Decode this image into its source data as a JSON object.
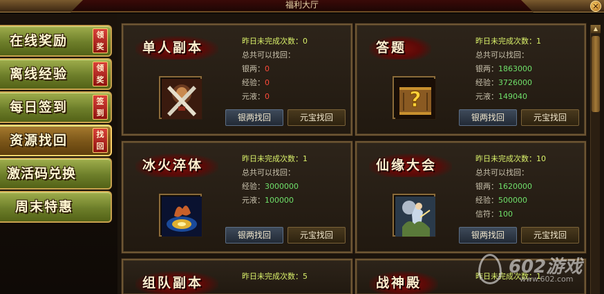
{
  "window": {
    "title": "福利大厅",
    "close_glyph": "✕"
  },
  "sidebar": {
    "items": [
      {
        "label": "在线奖励",
        "tag": "领奖",
        "active": false
      },
      {
        "label": "离线经验",
        "tag": "领奖",
        "active": false
      },
      {
        "label": "每日签到",
        "tag": "签到",
        "active": false
      },
      {
        "label": "资源找回",
        "tag": "找回",
        "active": true
      },
      {
        "label": "激活码兑换",
        "tag": "",
        "active": false
      },
      {
        "label": "周末特惠",
        "tag": "",
        "active": false
      }
    ]
  },
  "cards": [
    {
      "name": "单人副本",
      "icon": "crossed-swords-icon",
      "line1": "昨日未完成次数：0",
      "line2": "总共可以找回：",
      "rows": [
        {
          "label": "银两：",
          "value": "0",
          "zero": true
        },
        {
          "label": "经验：",
          "value": "0",
          "zero": true
        },
        {
          "label": "元液：",
          "value": "0",
          "zero": true
        }
      ],
      "btn_silver": "银两找回",
      "btn_gold": "元宝找回"
    },
    {
      "name": "答题",
      "icon": "question-scroll-icon",
      "line1": "昨日未完成次数：1",
      "line2": "总共可以找回：",
      "rows": [
        {
          "label": "银两：",
          "value": "1863000",
          "zero": false
        },
        {
          "label": "经验：",
          "value": "3726000",
          "zero": false
        },
        {
          "label": "元液：",
          "value": "149040",
          "zero": false
        }
      ],
      "btn_silver": "银两找回",
      "btn_gold": "元宝找回"
    },
    {
      "name": "冰火淬体",
      "icon": "fire-ice-orb-icon",
      "line1": "昨日未完成次数：1",
      "line2": "总共可以找回：",
      "rows": [
        {
          "label": "经验：",
          "value": "3000000",
          "zero": false
        },
        {
          "label": "元液：",
          "value": "100000",
          "zero": false
        }
      ],
      "btn_silver": "银两找回",
      "btn_gold": "元宝找回"
    },
    {
      "name": "仙缘大会",
      "icon": "immortal-figure-icon",
      "line1": "昨日未完成次数：10",
      "line2": "总共可以找回：",
      "rows": [
        {
          "label": "银两：",
          "value": "1620000",
          "zero": false
        },
        {
          "label": "经验：",
          "value": "500000",
          "zero": false
        },
        {
          "label": "信符：",
          "value": "100",
          "zero": false
        }
      ],
      "btn_silver": "银两找回",
      "btn_gold": "元宝找回"
    },
    {
      "name": "组队副本",
      "icon": "",
      "line1": "昨日未完成次数：5",
      "line2": "",
      "rows": [],
      "btn_silver": "",
      "btn_gold": ""
    },
    {
      "name": "战神殿",
      "icon": "",
      "line1": "昨日未完成次数：1",
      "line2": "",
      "rows": [],
      "btn_silver": "",
      "btn_gold": ""
    }
  ],
  "watermark": {
    "brand": "602游戏",
    "url": "www.602.com"
  },
  "colors": {
    "value_green": "#6fe06a",
    "value_zero": "#ff4a3a",
    "title_yellow": "#d9f06a",
    "side_green": "#6d7e2a",
    "side_active": "#7a5518"
  }
}
